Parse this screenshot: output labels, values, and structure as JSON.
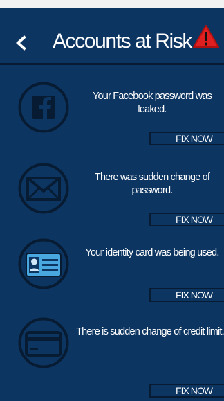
{
  "header": {
    "back_label": "<",
    "title": "Accounts at Risk",
    "warning_icon": "warning-triangle-icon"
  },
  "alerts": [
    {
      "icon": "facebook-icon",
      "message": "Your Facebook password was leaked.",
      "button_label": "FIX NOW"
    },
    {
      "icon": "mail-icon",
      "message": "There was sudden change of password.",
      "button_label": "FIX NOW"
    },
    {
      "icon": "id-card-icon",
      "message": "Your identity card was being used.",
      "button_label": "FIX NOW"
    },
    {
      "icon": "credit-card-icon",
      "message": "There is sudden change of credit limit.",
      "button_label": "FIX NOW"
    }
  ],
  "colors": {
    "background": "#0d3561",
    "outline": "#071c33",
    "warning": "#e02020",
    "id_card": "#4aa8e0"
  }
}
